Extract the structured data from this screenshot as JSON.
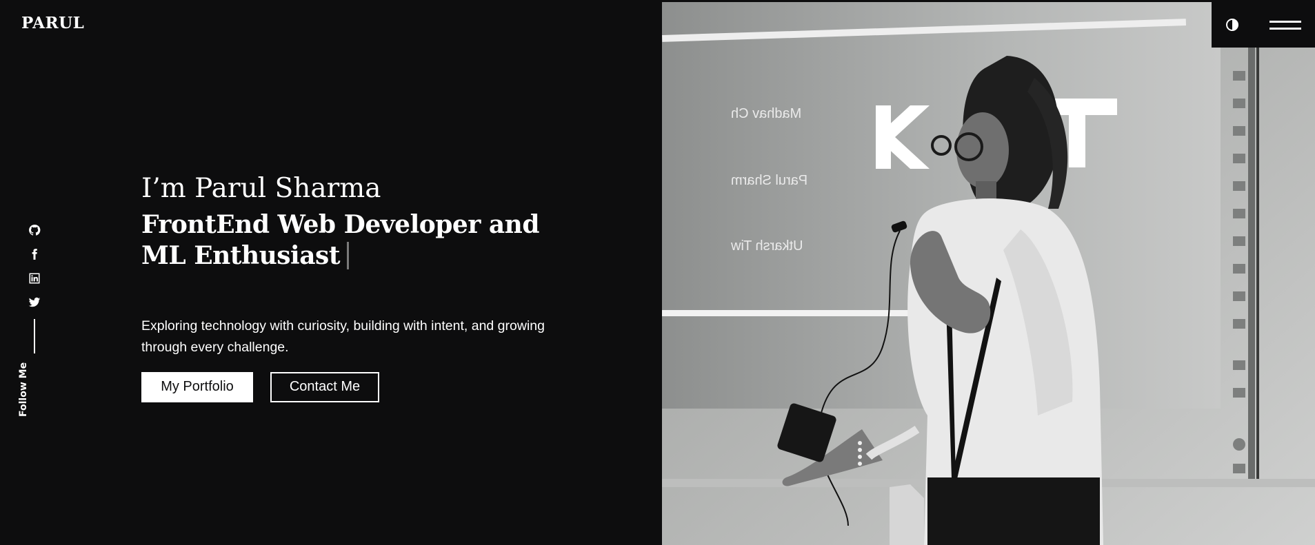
{
  "header": {
    "brand": "PARUL",
    "theme_toggle_icon": "contrast-icon",
    "menu_icon": "hamburger-menu-icon"
  },
  "social": {
    "items": [
      {
        "icon": "github-icon"
      },
      {
        "icon": "facebook-icon"
      },
      {
        "icon": "linkedin-icon"
      },
      {
        "icon": "twitter-icon"
      }
    ],
    "label": "Follow Me"
  },
  "hero": {
    "greeting": "I’m Parul Sharma",
    "role_line1": "FrontEnd Web Developer and",
    "role_line2": "ML Enthusiast",
    "tagline": "Exploring technology with curiosity, building with intent, and growing through every challenge.",
    "primary_button": "My Portfolio",
    "secondary_button": "Contact Me"
  },
  "photo": {
    "slide_names": [
      "Madhav Ch",
      "Parul Sharm",
      "Utkarsh Tiw"
    ]
  },
  "colors": {
    "background": "#0d0d0e",
    "text": "#ffffff",
    "cursor": "#7a7a7a"
  }
}
